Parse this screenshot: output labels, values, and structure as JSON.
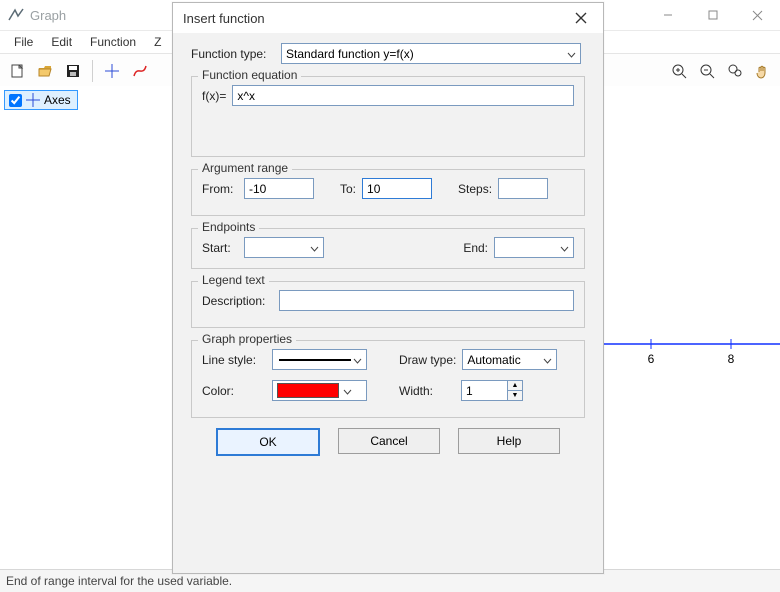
{
  "window": {
    "title": "Graph",
    "menu": [
      "File",
      "Edit",
      "Function",
      "Z"
    ],
    "status": "End of range interval for the used variable."
  },
  "axes_item_label": "Axes",
  "dialog": {
    "title": "Insert function",
    "function_type_lbl": "Function type:",
    "function_type_val": "Standard function   y=f(x)",
    "equation_group": "Function equation",
    "fx_lbl": "f(x)=",
    "fx_val": "x^x",
    "arg_group": "Argument range",
    "from_lbl": "From:",
    "from_val": "-10",
    "to_lbl": "To:",
    "to_val": "10",
    "steps_lbl": "Steps:",
    "steps_val": "",
    "endpoints_group": "Endpoints",
    "start_lbl": "Start:",
    "start_val": "",
    "end_lbl": "End:",
    "end_val": "",
    "legend_group": "Legend text",
    "desc_lbl": "Description:",
    "desc_val": "",
    "props_group": "Graph properties",
    "linestyle_lbl": "Line style:",
    "drawtype_lbl": "Draw type:",
    "drawtype_val": "Automatic",
    "color_lbl": "Color:",
    "color_val": "#ff0000",
    "width_lbl": "Width:",
    "width_val": "1",
    "ok": "OK",
    "cancel": "Cancel",
    "help": "Help"
  },
  "axis_ticks": {
    "t6": "6",
    "t8": "8"
  }
}
